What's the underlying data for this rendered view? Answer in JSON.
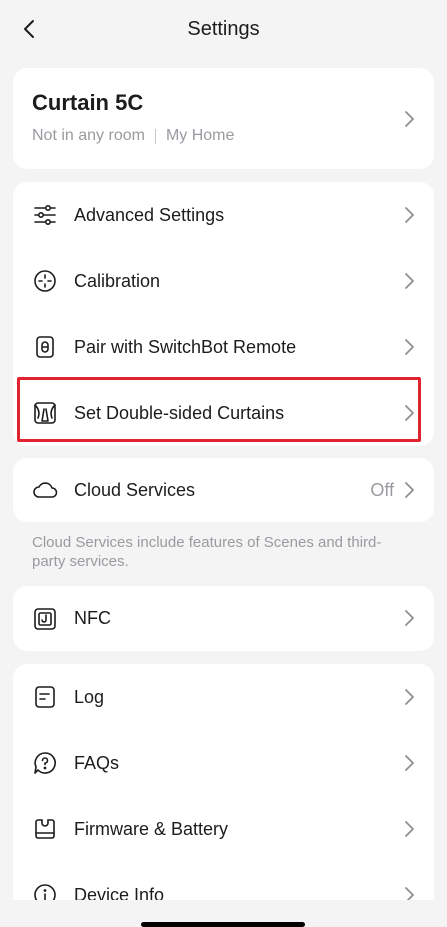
{
  "header": {
    "title": "Settings"
  },
  "device": {
    "name": "Curtain 5C",
    "room": "Not in any room",
    "home": "My Home"
  },
  "menu_group_1": [
    {
      "label": "Advanced Settings",
      "icon": "sliders-icon"
    },
    {
      "label": "Calibration",
      "icon": "crosshair-icon"
    },
    {
      "label": "Pair with SwitchBot Remote",
      "icon": "remote-icon"
    },
    {
      "label": "Set Double-sided Curtains",
      "icon": "curtain-icon"
    }
  ],
  "cloud": {
    "label": "Cloud Services",
    "value": "Off",
    "icon": "cloud-icon"
  },
  "cloud_note": "Cloud Services include features of Scenes and third-party services.",
  "nfc": {
    "label": "NFC",
    "icon": "nfc-icon"
  },
  "menu_group_3": [
    {
      "label": "Log",
      "icon": "document-icon"
    },
    {
      "label": "FAQs",
      "icon": "help-bubble-icon"
    },
    {
      "label": "Firmware & Battery",
      "icon": "firmware-icon"
    },
    {
      "label": "Device Info",
      "icon": "info-icon"
    }
  ],
  "colors": {
    "highlight": "#e0232e",
    "background": "#f4f4f5",
    "card": "#ffffff"
  }
}
